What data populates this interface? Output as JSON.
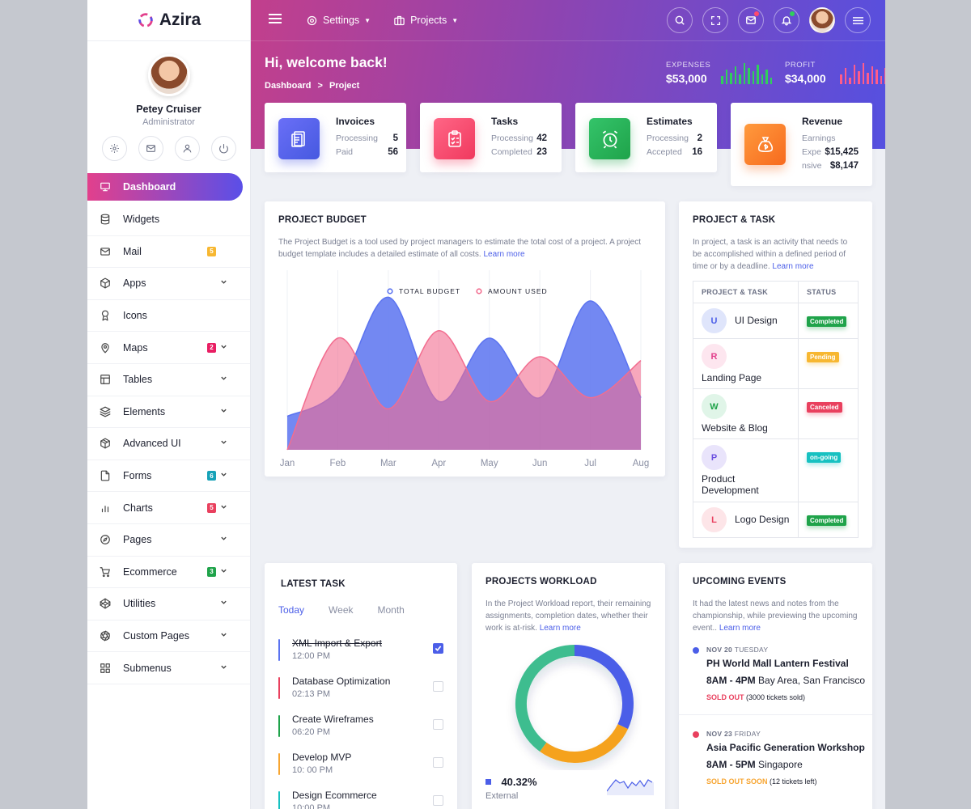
{
  "brand": {
    "name": "Azira",
    "accent": "#5a4fe8",
    "pink": "#e2408c"
  },
  "profile": {
    "name": "Petey Cruiser",
    "role": "Administrator",
    "icons": [
      "gear-icon",
      "mail-icon",
      "user-icon",
      "power-icon"
    ]
  },
  "nav": [
    {
      "label": "Dashboard",
      "icon": "monitor-icon",
      "active": true
    },
    {
      "label": "Widgets",
      "icon": "database-icon"
    },
    {
      "label": "Mail",
      "icon": "mail-icon",
      "badge": "5",
      "badge_color": "#f7b731"
    },
    {
      "label": "Apps",
      "icon": "box-icon",
      "chevron": true
    },
    {
      "label": "Icons",
      "icon": "award-icon"
    },
    {
      "label": "Maps",
      "icon": "map-pin-icon",
      "badge": "2",
      "badge_color": "#e91e63",
      "chevron": true
    },
    {
      "label": "Tables",
      "icon": "table-icon",
      "chevron": true
    },
    {
      "label": "Elements",
      "icon": "layers-icon",
      "chevron": true
    },
    {
      "label": "Advanced UI",
      "icon": "package-icon",
      "chevron": true
    },
    {
      "label": "Forms",
      "icon": "file-icon",
      "badge": "6",
      "badge_color": "#17a2b8",
      "chevron": true
    },
    {
      "label": "Charts",
      "icon": "bar-chart-icon",
      "badge": "5",
      "badge_color": "#e9405e",
      "chevron": true
    },
    {
      "label": "Pages",
      "icon": "compass-icon",
      "chevron": true
    },
    {
      "label": "Ecommerce",
      "icon": "cart-icon",
      "badge": "3",
      "badge_color": "#1fa34a",
      "chevron": true
    },
    {
      "label": "Utilities",
      "icon": "codepen-icon",
      "chevron": true
    },
    {
      "label": "Custom Pages",
      "icon": "aperture-icon",
      "chevron": true
    },
    {
      "label": "Submenus",
      "icon": "grid-icon",
      "chevron": true
    }
  ],
  "topbar": {
    "settings": "Settings",
    "projects": "Projects"
  },
  "header": {
    "greeting": "Hi, welcome back!",
    "crumb1": "Dashboard",
    "crumb_sep": ">",
    "crumb2": "Project",
    "expenses_label": "EXPENSES",
    "expenses_value": "$53,000",
    "expenses_color": "#2fd05b",
    "profit_label": "PROFIT",
    "profit_value": "$34,000",
    "profit_color": "#ff5c8a"
  },
  "summary": {
    "invoices": {
      "title": "Invoices",
      "r1": "Processing",
      "v1": "5",
      "r2": "Paid",
      "v2": "56"
    },
    "tasks": {
      "title": "Tasks",
      "r1": "Processing",
      "v1": "42",
      "r2": "Completed",
      "v2": "23"
    },
    "estimates": {
      "title": "Estimates",
      "r1": "Processing",
      "v1": "2",
      "r2": "Accepted",
      "v2": "16"
    },
    "revenue": {
      "title": "Revenue",
      "r0": "Earnings",
      "r1": "Expe",
      "v1": "$15,425",
      "r2": "nsive",
      "v2": "$8,147"
    }
  },
  "budget": {
    "title": "PROJECT BUDGET",
    "desc": "The Project Budget is a tool used by project managers to estimate the total cost of a project. A project budget template includes a detailed estimate of all costs.",
    "link": "Learn more"
  },
  "chart_data": {
    "type": "area",
    "categories": [
      "Jan",
      "Feb",
      "Mar",
      "Apr",
      "May",
      "Jun",
      "Jul",
      "Aug"
    ],
    "series": [
      {
        "name": "TOTAL BUDGET",
        "color": "#5b73f0",
        "values": [
          18,
          32,
          82,
          26,
          60,
          28,
          80,
          28
        ]
      },
      {
        "name": "AMOUNT USED",
        "color": "#f26d8f",
        "values": [
          0,
          60,
          22,
          64,
          26,
          50,
          28,
          48
        ]
      }
    ],
    "ylim": [
      0,
      90
    ],
    "legend": "top-center",
    "grid": "vertical"
  },
  "projtask": {
    "title": "PROJECT & TASK",
    "desc": "In project, a task is an activity that needs to be accomplished within a defined period of time or by a deadline.",
    "link": "Learn more",
    "col1": "PROJECT & TASK",
    "col2": "STATUS",
    "rows": [
      {
        "letter": "U",
        "name": "UI Design",
        "status": "Completed",
        "color": "#1fa34a"
      },
      {
        "letter": "R",
        "name": "Landing Page",
        "status": "Pending",
        "color": "#f7b731"
      },
      {
        "letter": "W",
        "name": "Website & Blog",
        "status": "Canceled",
        "color": "#e9405e"
      },
      {
        "letter": "P",
        "name": "Product Development",
        "status": "on-going",
        "color": "#17c1c1"
      },
      {
        "letter": "L",
        "name": "Logo Design",
        "status": "Completed",
        "color": "#1fa34a"
      }
    ]
  },
  "latest": {
    "title": "LATEST TASK",
    "tabs": [
      "Today",
      "Week",
      "Month"
    ],
    "items": [
      {
        "name": "XML Import & Export",
        "time": "12:00 PM",
        "color": "#5b73f0",
        "done": true
      },
      {
        "name": "Database Optimization",
        "time": "02:13 PM",
        "color": "#e9405e"
      },
      {
        "name": "Create Wireframes",
        "time": "06:20 PM",
        "color": "#1fa34a"
      },
      {
        "name": "Develop MVP",
        "time": "10: 00 PM",
        "color": "#f7a531"
      },
      {
        "name": "Design Ecommerce",
        "time": "10:00 PM",
        "color": "#17c1c1"
      }
    ]
  },
  "workload": {
    "title": "PROJECTS WORKLOAD",
    "desc": "In the Project Workload report, their remaining assignments, completion dates, whether their work is at-risk.",
    "link": "Learn more",
    "pct": "40.32%",
    "pct_label": "External",
    "donut": [
      {
        "color": "#4b5ee8",
        "value": 32
      },
      {
        "color": "#f5a21d",
        "value": 28
      },
      {
        "color": "#3ebd8f",
        "value": 40
      }
    ]
  },
  "events": {
    "title": "UPCOMING EVENTS",
    "desc": "It had the latest news and notes from the championship, while previewing the upcoming event..",
    "link": "Learn more",
    "items": [
      {
        "date": "NOV 20",
        "day": "TUESDAY",
        "name": "PH World Mall Lantern Festival",
        "time": "8AM - 4PM",
        "place": "Bay Area, San Francisco",
        "status": "SOLD OUT",
        "note": "(3000 tickets sold)",
        "dot": "#4b5ee8",
        "status_color": "#e9405e"
      },
      {
        "date": "NOV 23",
        "day": "FRIDAY",
        "name": "Asia Pacific Generation Workshop",
        "time": "8AM - 5PM",
        "place": "Singapore",
        "status": "SOLD OUT SOON",
        "note": "(12 tickets left)",
        "dot": "#e9405e",
        "status_color": "#f7a531"
      }
    ]
  }
}
